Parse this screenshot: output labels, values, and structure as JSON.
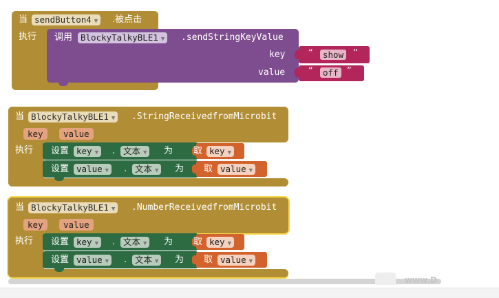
{
  "block1": {
    "when": "当",
    "component": "sendButton4",
    "event": ".被点击",
    "do": "执行",
    "call": "调用",
    "call_component": "BlockyTalkyBLE1",
    "method": ".sendStringKeyValue",
    "arg1_label": "key",
    "arg2_label": "value",
    "arg1_value": "show",
    "arg2_value": "off",
    "quote_open": "“",
    "quote_close": "”"
  },
  "block2": {
    "when": "当",
    "component": "BlockyTalkyBLE1",
    "event": ".StringReceivedfromMicrobit",
    "param1": "key",
    "param2": "value",
    "do": "执行",
    "rows": [
      {
        "set": "设置",
        "target": "key",
        "dot": ".",
        "prop": "文本",
        "to": "为",
        "get": "取",
        "var": "key"
      },
      {
        "set": "设置",
        "target": "value",
        "dot": ".",
        "prop": "文本",
        "to": "为",
        "get": "取",
        "var": "value"
      }
    ]
  },
  "block3": {
    "when": "当",
    "component": "BlockyTalkyBLE1",
    "event": ".NumberReceivedfromMicrobit",
    "param1": "key",
    "param2": "value",
    "do": "执行",
    "rows": [
      {
        "set": "设置",
        "target": "key",
        "dot": ".",
        "prop": "文本",
        "to": "为",
        "get": "取",
        "var": "key"
      },
      {
        "set": "设置",
        "target": "value",
        "dot": ".",
        "prop": "文本",
        "to": "为",
        "get": "取",
        "var": "value"
      }
    ]
  },
  "watermark": "www.D",
  "colors": {
    "event": "#b18e35",
    "highlight": "#f7d84a",
    "procedure_call": "#7e4d8f",
    "text_block": "#b3265c",
    "setter": "#2d6b43",
    "getter": "#d2632c"
  }
}
